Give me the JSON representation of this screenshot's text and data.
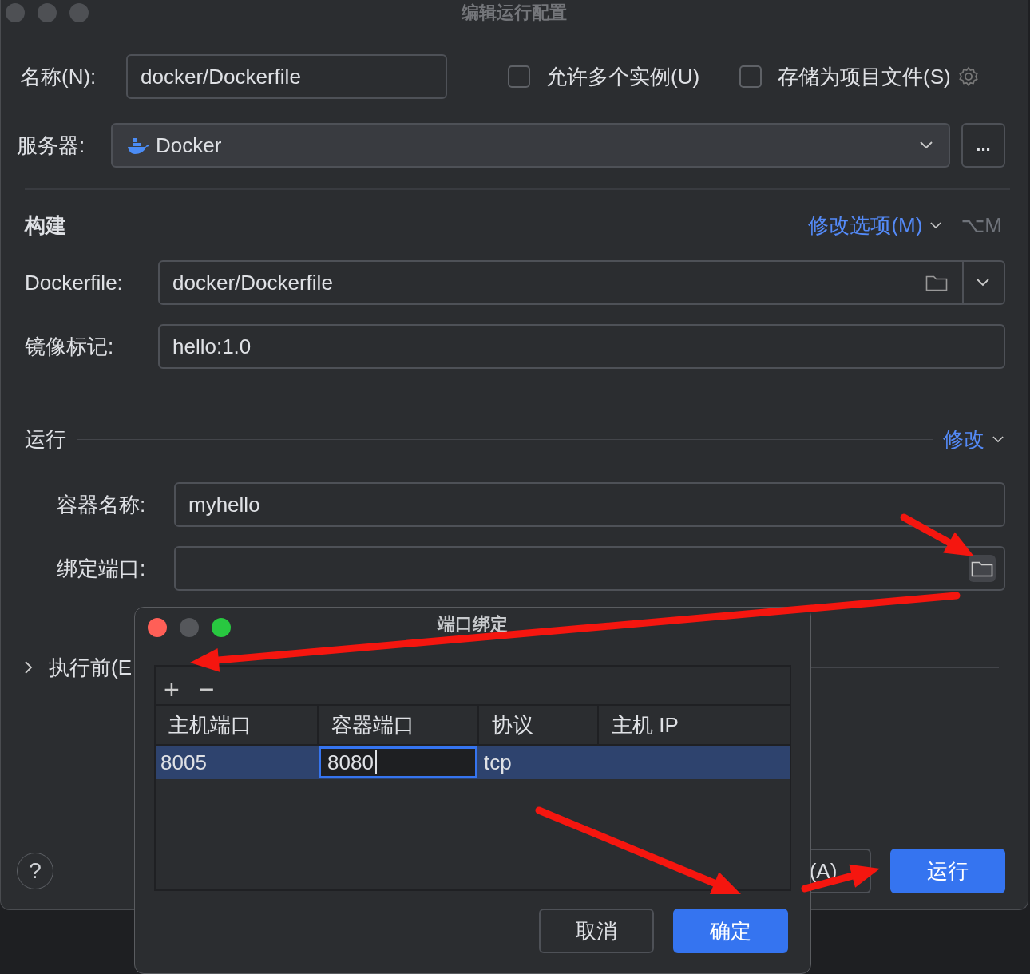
{
  "window": {
    "title": "编辑运行配置"
  },
  "name_row": {
    "label": "名称(N):",
    "value": "docker/Dockerfile"
  },
  "options": [
    {
      "label": "允许多个实例(U)",
      "checked": false
    },
    {
      "label": "存储为项目文件(S)",
      "checked": false
    }
  ],
  "server": {
    "label": "服务器:",
    "value": "Docker",
    "more_button": "..."
  },
  "build": {
    "title": "构建",
    "modify_link": "修改选项(M)",
    "shortcut": "⌥M",
    "fields": [
      {
        "label": "Dockerfile:",
        "value": "docker/Dockerfile",
        "kind": "file-combo"
      },
      {
        "label": "镜像标记:",
        "value": "hello:1.0",
        "kind": "text"
      }
    ]
  },
  "run": {
    "title": "运行",
    "modify_link": "修改",
    "fields": [
      {
        "label": "容器名称:",
        "value": "myhello",
        "kind": "text"
      },
      {
        "label": "绑定端口:",
        "kind": "browse"
      }
    ]
  },
  "before_launch": {
    "label": "执行前(E",
    "expanded": false
  },
  "footer": {
    "help": "?",
    "apply_button": "(A)",
    "run_button": "运行"
  },
  "port_dialog": {
    "title": "端口绑定",
    "toolbar": [
      "+",
      "−"
    ],
    "columns": [
      "主机端口",
      "容器端口",
      "协议",
      "主机 IP"
    ],
    "rows": [
      {
        "selected": true,
        "cells": [
          {
            "text": "8005",
            "editing": false
          },
          {
            "text": "8080",
            "editing": true
          },
          {
            "text": "tcp",
            "editing": false
          }
        ]
      }
    ],
    "buttons": [
      {
        "label": "取消",
        "primary": false
      },
      {
        "label": "确定",
        "primary": true
      }
    ]
  }
}
